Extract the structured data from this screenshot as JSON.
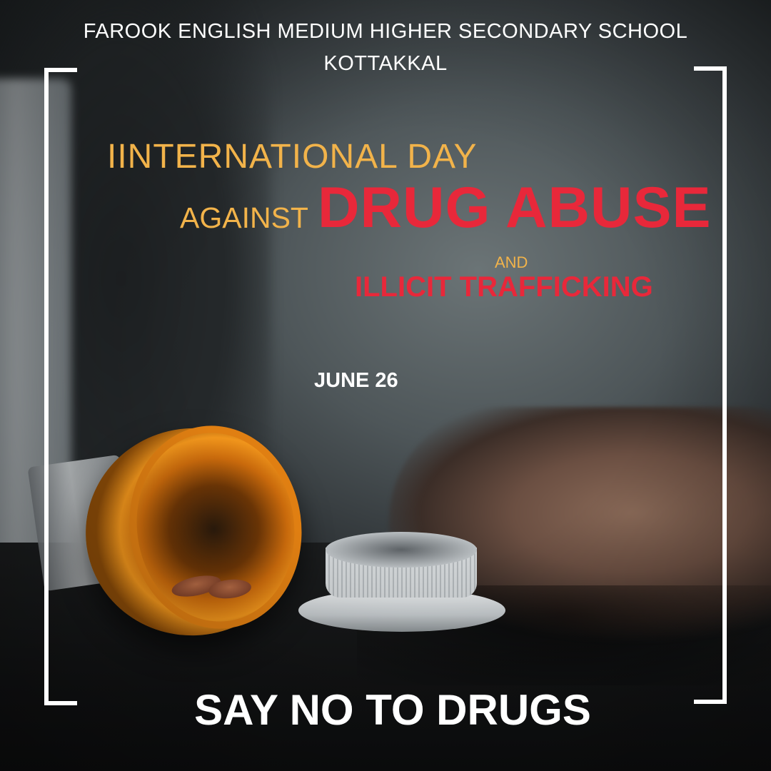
{
  "header": {
    "school_name": "FAROOK ENGLISH MEDIUM HIGHER SECONDARY SCHOOL",
    "school_place": "KOTTAKKAL"
  },
  "title": {
    "line1": "IINTERNATIONAL DAY",
    "against": "AGAINST",
    "drug_abuse": "DRUG ABUSE",
    "and": "AND",
    "illicit": "ILLICIT TRAFFICKING"
  },
  "date": "JUNE 26",
  "slogan": "SAY NO TO DRUGS",
  "colors": {
    "accent_gold": "#f2b34a",
    "accent_red": "#e8283a",
    "text_white": "#ffffff"
  }
}
